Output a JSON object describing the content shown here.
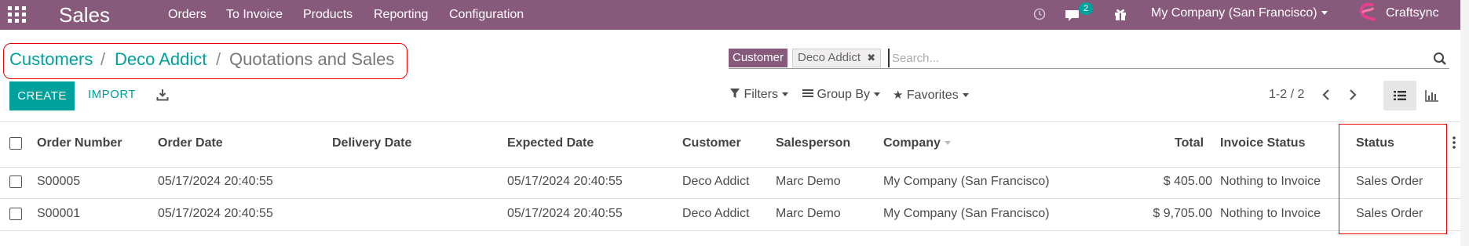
{
  "navbar": {
    "app_title": "Sales",
    "menu": [
      "Orders",
      "To Invoice",
      "Products",
      "Reporting",
      "Configuration"
    ],
    "messages_count": "2",
    "company": "My Company (San Francisco)",
    "user": "Craftsync"
  },
  "breadcrumb": {
    "items": [
      "Customers",
      "Deco Addict"
    ],
    "separator": "/",
    "current": "Quotations and Sales"
  },
  "search": {
    "facet_label": "Customer",
    "facet_value": "Deco Addict",
    "facet_remove": "✖",
    "placeholder": "Search..."
  },
  "buttons": {
    "create": "CREATE",
    "import": "IMPORT"
  },
  "controls": {
    "filters": "Filters",
    "group_by": "Group By",
    "favorites": "Favorites"
  },
  "pager": {
    "value": "1-2 / 2"
  },
  "table": {
    "columns": {
      "order_number": "Order Number",
      "order_date": "Order Date",
      "delivery_date": "Delivery Date",
      "expected_date": "Expected Date",
      "customer": "Customer",
      "salesperson": "Salesperson",
      "company": "Company",
      "total": "Total",
      "invoice_status": "Invoice Status",
      "status": "Status"
    },
    "rows": [
      {
        "order_number": "S00005",
        "order_date": "05/17/2024 20:40:55",
        "delivery_date": "",
        "expected_date": "05/17/2024 20:40:55",
        "customer": "Deco Addict",
        "salesperson": "Marc Demo",
        "company": "My Company (San Francisco)",
        "total": "$ 405.00",
        "invoice_status": "Nothing to Invoice",
        "status": "Sales Order"
      },
      {
        "order_number": "S00001",
        "order_date": "05/17/2024 20:40:55",
        "delivery_date": "",
        "expected_date": "05/17/2024 20:40:55",
        "customer": "Deco Addict",
        "salesperson": "Marc Demo",
        "company": "My Company (San Francisco)",
        "total": "$ 9,705.00",
        "invoice_status": "Nothing to Invoice",
        "status": "Sales Order"
      }
    ]
  },
  "colors": {
    "brand": "#875a7b",
    "accent": "#00a09d",
    "highlight_box": "#e00000"
  }
}
